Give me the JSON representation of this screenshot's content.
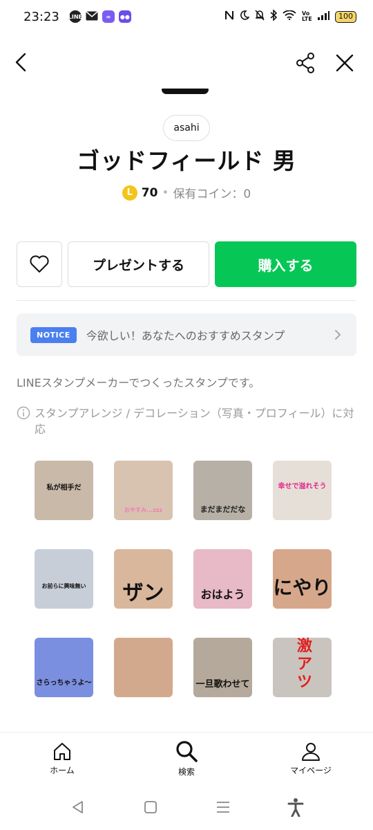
{
  "status_bar": {
    "time": "23:23",
    "battery": "100",
    "volte": "Vo LTE"
  },
  "product": {
    "creator": "asahi",
    "title": "ゴッドフィールド 男",
    "coin_icon": "L",
    "price": "70",
    "separator": "•",
    "owned_coins": "保有コイン：0"
  },
  "actions": {
    "present_label": "プレゼントする",
    "buy_label": "購入する"
  },
  "notice": {
    "badge": "NOTICE",
    "text": "今欲しい！あなたへのおすすめスタンプ"
  },
  "description": "LINEスタンプメーカーでつくったスタンプです。",
  "arrange_note": "スタンプアレンジ / デコレーション（写真・プロフィール）に対応",
  "stickers": [
    {
      "caption": "私が相手だ",
      "color": "#c9b9a8"
    },
    {
      "caption": "おやすみ...zzz",
      "color": "#d8c3b0"
    },
    {
      "caption": "まだまだだな",
      "color": "#b7b0a6"
    },
    {
      "caption": "幸せで溢れそう",
      "color": "#e6dfd7"
    },
    {
      "caption": "お前らに興味無い",
      "color": "#c7ced8"
    },
    {
      "caption": "ザン",
      "color": "#d9b79c"
    },
    {
      "caption": "おはよう",
      "color": "#e8b9c7"
    },
    {
      "caption": "にやり",
      "color": "#d7a78b"
    },
    {
      "caption": "さらっちゃうよ〜",
      "color": "#7b8fe0"
    },
    {
      "caption": "",
      "color": "#d3a98d"
    },
    {
      "caption": "一旦歌わせて",
      "color": "#b4a99b"
    },
    {
      "caption": "激アツ",
      "color": "#c9c4be"
    }
  ],
  "bottom_nav": {
    "home": "ホーム",
    "search": "検索",
    "mypage": "マイページ"
  },
  "colors": {
    "buy_green": "#06c755",
    "notice_blue": "#4a7ff0",
    "coin_yellow": "#f4c418"
  }
}
